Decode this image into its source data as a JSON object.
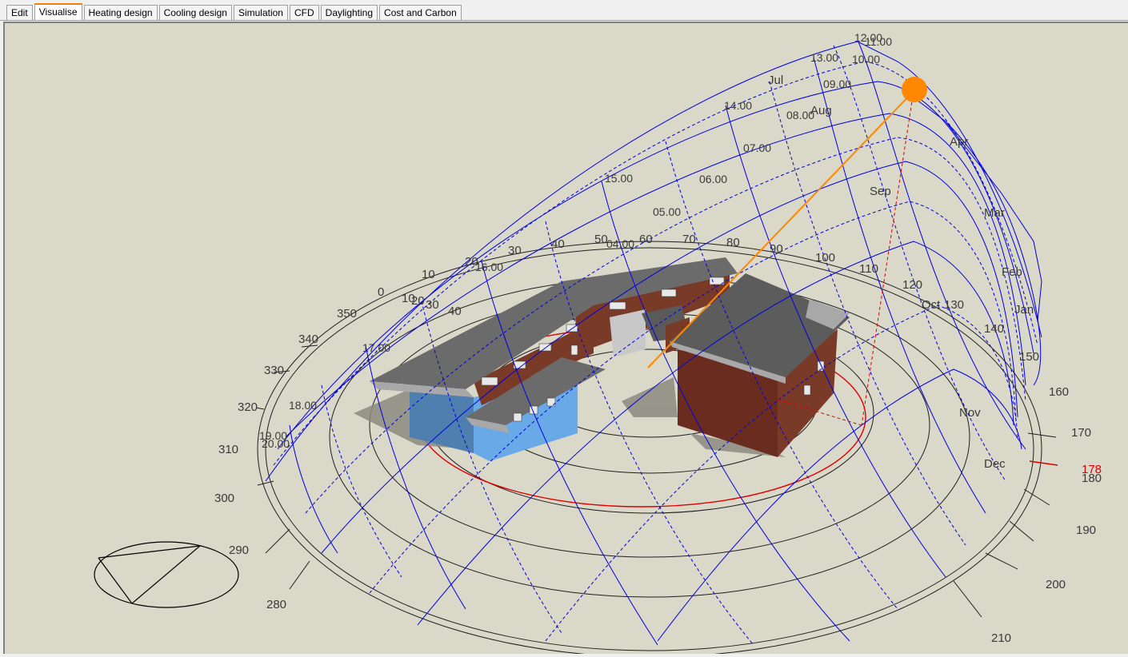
{
  "tabs": [
    {
      "label": "Edit"
    },
    {
      "label": "Visualise"
    },
    {
      "label": "Heating design"
    },
    {
      "label": "Cooling design"
    },
    {
      "label": "Simulation"
    },
    {
      "label": "CFD"
    },
    {
      "label": "Daylighting"
    },
    {
      "label": "Cost and Carbon"
    }
  ],
  "active_tab": "Visualise",
  "sun_path": {
    "azimuth_labels": [
      "0",
      "10",
      "20",
      "30",
      "40",
      "50",
      "60",
      "70",
      "80",
      "90",
      "100",
      "110",
      "120",
      "130",
      "140",
      "150",
      "160",
      "170",
      "180",
      "190",
      "200",
      "210",
      "280",
      "290",
      "300",
      "310",
      "320",
      "330",
      "340",
      "350"
    ],
    "elevation_labels": [
      "10",
      "20",
      "30",
      "40"
    ],
    "hour_labels": [
      "12.00",
      "11.00",
      "13.00",
      "10.00",
      "09.00",
      "14.00",
      "08.00",
      "07.00",
      "15.00",
      "06.00",
      "05.00",
      "04.00",
      "16.00",
      "17.00",
      "18.00",
      "19.00",
      "20.00"
    ],
    "month_labels": [
      "Jul",
      "Aug",
      "Apr",
      "Sep",
      "Mar",
      "Feb",
      "Jan",
      "Oct",
      "Nov",
      "Dec"
    ],
    "current_azimuth": "178",
    "sun_color": "#ff8800",
    "grid_color": "#0000e0",
    "highlight_color": "#e00000"
  }
}
